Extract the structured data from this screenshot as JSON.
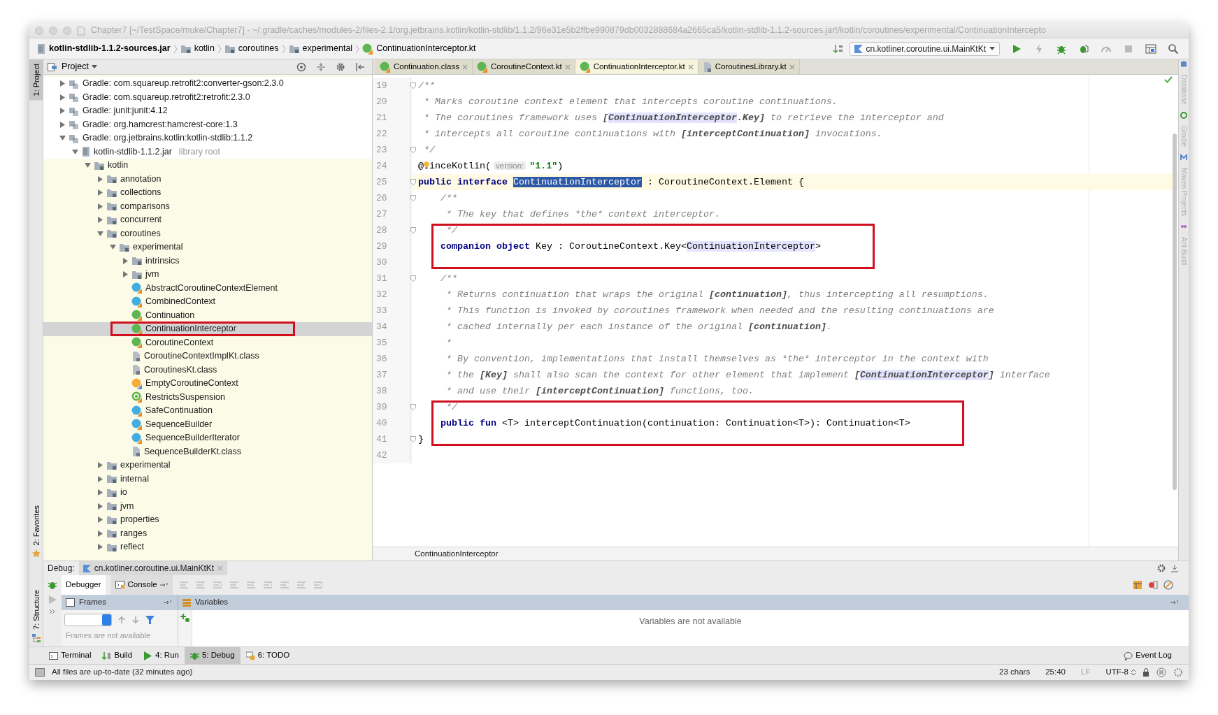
{
  "window": {
    "title": "Chapter7 [~/TestSpace/muke/Chapter7] - ~/.gradle/caches/modules-2/files-2.1/org.jetbrains.kotlin/kotlin-stdlib/1.1.2/96e31e5b2ffbe990879db0032888684a2665ca5/kotlin-stdlib-1.1.2-sources.jar!/kotlin/coroutines/experimental/ContinuationIntercepto"
  },
  "nav_bar": {
    "crumbs": [
      {
        "label": "kotlin-stdlib-1.1.2-sources.jar",
        "kind": "jar"
      },
      {
        "label": "kotlin",
        "kind": "package"
      },
      {
        "label": "coroutines",
        "kind": "package"
      },
      {
        "label": "experimental",
        "kind": "package"
      },
      {
        "label": "ContinuationInterceptor.kt",
        "kind": "interface"
      }
    ],
    "run_config": "cn.kotliner.coroutine.ui.MainKtKt"
  },
  "left_stripe": [
    {
      "label": "1: Project",
      "selected": true
    },
    {
      "label": "2: Favorites",
      "selected": false
    },
    {
      "label": "7: Structure",
      "selected": false
    }
  ],
  "right_stripe": [
    {
      "label": "Database",
      "kind": "database"
    },
    {
      "label": "Gradle",
      "kind": "gradle"
    },
    {
      "label": "Maven Projects",
      "kind": "maven"
    },
    {
      "label": "Ant Build",
      "kind": "ant"
    }
  ],
  "project_panel": {
    "title": "Project",
    "tree": [
      {
        "label": "Gradle: com.squareup.retrofit2:converter-gson:2.3.0",
        "kind": "library",
        "expanded": false,
        "selected": false
      },
      {
        "label": "Gradle: com.squareup.retrofit2:retrofit:2.3.0",
        "kind": "library",
        "expanded": false,
        "selected": false
      },
      {
        "label": "Gradle: junit:junit:4.12",
        "kind": "library",
        "expanded": false,
        "selected": false
      },
      {
        "label": "Gradle: org.hamcrest:hamcrest-core:1.3",
        "kind": "library",
        "expanded": false,
        "selected": false
      },
      {
        "label": "Gradle: org.jetbrains.kotlin:kotlin-stdlib:1.1.2",
        "kind": "library",
        "expanded": true,
        "selected": false,
        "children": [
          {
            "label": "kotlin-stdlib-1.1.2.jar",
            "note": "library root",
            "kind": "jar",
            "expanded": true,
            "selected": false,
            "children": [
              {
                "label": "kotlin",
                "kind": "package",
                "expanded": true,
                "selected": false,
                "children": [
                  {
                    "label": "annotation",
                    "kind": "package",
                    "expanded": false,
                    "selected": false
                  },
                  {
                    "label": "collections",
                    "kind": "package",
                    "expanded": false,
                    "selected": false
                  },
                  {
                    "label": "comparisons",
                    "kind": "package",
                    "expanded": false,
                    "selected": false
                  },
                  {
                    "label": "concurrent",
                    "kind": "package",
                    "expanded": false,
                    "selected": false
                  },
                  {
                    "label": "coroutines",
                    "kind": "package",
                    "expanded": true,
                    "selected": false,
                    "children": [
                      {
                        "label": "experimental",
                        "kind": "package",
                        "expanded": true,
                        "selected": false,
                        "children": [
                          {
                            "label": "intrinsics",
                            "kind": "package",
                            "expanded": false,
                            "selected": false
                          },
                          {
                            "label": "jvm",
                            "kind": "package",
                            "expanded": false,
                            "selected": false
                          },
                          {
                            "label": "AbstractCoroutineContextElement",
                            "kind": "class",
                            "selected": false
                          },
                          {
                            "label": "CombinedContext",
                            "kind": "class",
                            "selected": false
                          },
                          {
                            "label": "Continuation",
                            "kind": "interface",
                            "selected": false
                          },
                          {
                            "label": "ContinuationInterceptor",
                            "kind": "interface",
                            "selected": true,
                            "boxed": true
                          },
                          {
                            "label": "CoroutineContext",
                            "kind": "interface",
                            "selected": false
                          },
                          {
                            "label": "CoroutineContextImplKt.class",
                            "kind": "file",
                            "selected": false
                          },
                          {
                            "label": "CoroutinesKt.class",
                            "kind": "file",
                            "selected": false
                          },
                          {
                            "label": "EmptyCoroutineContext",
                            "kind": "object",
                            "selected": false
                          },
                          {
                            "label": "RestrictsSuspension",
                            "kind": "annotation",
                            "selected": false
                          },
                          {
                            "label": "SafeContinuation",
                            "kind": "class",
                            "selected": false
                          },
                          {
                            "label": "SequenceBuilder",
                            "kind": "class",
                            "selected": false
                          },
                          {
                            "label": "SequenceBuilderIterator",
                            "kind": "class",
                            "selected": false
                          },
                          {
                            "label": "SequenceBuilderKt.class",
                            "kind": "file",
                            "selected": false
                          }
                        ]
                      }
                    ]
                  },
                  {
                    "label": "experimental",
                    "kind": "package",
                    "expanded": false,
                    "selected": false
                  },
                  {
                    "label": "internal",
                    "kind": "package",
                    "expanded": false,
                    "selected": false
                  },
                  {
                    "label": "io",
                    "kind": "package",
                    "expanded": false,
                    "selected": false
                  },
                  {
                    "label": "jvm",
                    "kind": "package",
                    "expanded": false,
                    "selected": false
                  },
                  {
                    "label": "properties",
                    "kind": "package",
                    "expanded": false,
                    "selected": false
                  },
                  {
                    "label": "ranges",
                    "kind": "package",
                    "expanded": false,
                    "selected": false
                  },
                  {
                    "label": "reflect",
                    "kind": "package",
                    "expanded": false,
                    "selected": false
                  }
                ]
              }
            ]
          }
        ]
      }
    ]
  },
  "editor": {
    "tabs": [
      {
        "label": "Continuation.class",
        "kind": "interface",
        "selected": false
      },
      {
        "label": "CoroutineContext.kt",
        "kind": "interface",
        "selected": false
      },
      {
        "label": "ContinuationInterceptor.kt",
        "kind": "interface",
        "selected": true
      },
      {
        "label": "CoroutinesLibrary.kt",
        "kind": "file",
        "selected": false
      }
    ],
    "lines": [
      {
        "number": "19",
        "fold": true,
        "current": false,
        "tokens": [
          {
            "kind": "comment",
            "text": "/**"
          }
        ]
      },
      {
        "number": "20",
        "fold": false,
        "current": false,
        "tokens": [
          {
            "kind": "comment",
            "text": " * Marks coroutine context element that intercepts coroutine continuations."
          }
        ]
      },
      {
        "number": "21",
        "fold": false,
        "current": false,
        "tokens": [
          {
            "kind": "comment",
            "text": " * The coroutines framework uses "
          },
          {
            "kind": "docref",
            "text": "["
          },
          {
            "kind": "docref-hl",
            "text": "ContinuationInterceptor"
          },
          {
            "kind": "docref",
            "text": ".Key]"
          },
          {
            "kind": "comment",
            "text": " to retrieve the interceptor and"
          }
        ]
      },
      {
        "number": "22",
        "fold": false,
        "current": false,
        "tokens": [
          {
            "kind": "comment",
            "text": " * intercepts all coroutine continuations with "
          },
          {
            "kind": "docref",
            "text": "[interceptContinuation]"
          },
          {
            "kind": "comment",
            "text": " invocations."
          }
        ]
      },
      {
        "number": "23",
        "fold": true,
        "current": false,
        "tokens": [
          {
            "kind": "comment",
            "text": " */"
          }
        ]
      },
      {
        "number": "24",
        "fold": false,
        "current": false,
        "tokens": [
          {
            "kind": "plain",
            "text": "@"
          },
          {
            "kind": "bulb"
          },
          {
            "kind": "plain",
            "text": "inceKotlin("
          },
          {
            "kind": "hint",
            "text": "version:"
          },
          {
            "kind": "string",
            "text": "\"1.1\""
          },
          {
            "kind": "plain",
            "text": ")"
          }
        ]
      },
      {
        "number": "25",
        "fold": true,
        "current": true,
        "tokens": [
          {
            "kind": "keyword",
            "text": "public interface "
          },
          {
            "kind": "selection",
            "text": "ContinuationInterceptor"
          },
          {
            "kind": "plain",
            "text": " : CoroutineContext.Element {"
          }
        ]
      },
      {
        "number": "26",
        "fold": true,
        "current": false,
        "tokens": [
          {
            "kind": "comment",
            "text": "    /**"
          }
        ]
      },
      {
        "number": "27",
        "fold": false,
        "current": false,
        "tokens": [
          {
            "kind": "comment",
            "text": "     * The key that defines *the* context interceptor."
          }
        ]
      },
      {
        "number": "28",
        "fold": true,
        "current": false,
        "tokens": [
          {
            "kind": "comment",
            "text": "     */"
          }
        ]
      },
      {
        "number": "29",
        "fold": false,
        "current": false,
        "boxed": true,
        "tokens": [
          {
            "kind": "keyword",
            "text": "    companion object "
          },
          {
            "kind": "plain",
            "text": "Key : CoroutineContext.Key<"
          },
          {
            "kind": "ident-hl",
            "text": "ContinuationInterceptor"
          },
          {
            "kind": "plain",
            "text": ">"
          }
        ]
      },
      {
        "number": "30",
        "fold": false,
        "current": false
      },
      {
        "number": "31",
        "fold": true,
        "current": false,
        "tokens": [
          {
            "kind": "comment",
            "text": "    /**"
          }
        ]
      },
      {
        "number": "32",
        "fold": false,
        "current": false,
        "tokens": [
          {
            "kind": "comment",
            "text": "     * Returns continuation that wraps the original "
          },
          {
            "kind": "docref",
            "text": "[continuation]"
          },
          {
            "kind": "comment",
            "text": ", thus intercepting all resumptions."
          }
        ]
      },
      {
        "number": "33",
        "fold": false,
        "current": false,
        "tokens": [
          {
            "kind": "comment",
            "text": "     * This function is invoked by coroutines framework when needed and the resulting continuations are"
          }
        ]
      },
      {
        "number": "34",
        "fold": false,
        "current": false,
        "tokens": [
          {
            "kind": "comment",
            "text": "     * cached internally per each instance of the original "
          },
          {
            "kind": "docref",
            "text": "[continuation]"
          },
          {
            "kind": "comment",
            "text": "."
          }
        ]
      },
      {
        "number": "35",
        "fold": false,
        "current": false,
        "tokens": [
          {
            "kind": "comment",
            "text": "     *"
          }
        ]
      },
      {
        "number": "36",
        "fold": false,
        "current": false,
        "tokens": [
          {
            "kind": "comment",
            "text": "     * By convention, implementations that install themselves as *the* interceptor in the context with"
          }
        ]
      },
      {
        "number": "37",
        "fold": false,
        "current": false,
        "tokens": [
          {
            "kind": "comment",
            "text": "     * the "
          },
          {
            "kind": "docref",
            "text": "[Key]"
          },
          {
            "kind": "comment",
            "text": " shall also scan the context for other element that implement "
          },
          {
            "kind": "docref",
            "text": "["
          },
          {
            "kind": "docref-hl",
            "text": "ContinuationInterceptor"
          },
          {
            "kind": "docref",
            "text": "]"
          },
          {
            "kind": "comment",
            "text": " interface"
          }
        ]
      },
      {
        "number": "38",
        "fold": false,
        "current": false,
        "tokens": [
          {
            "kind": "comment",
            "text": "     * and use their "
          },
          {
            "kind": "docref",
            "text": "[interceptContinuation]"
          },
          {
            "kind": "comment",
            "text": " functions, too."
          }
        ]
      },
      {
        "number": "39",
        "fold": true,
        "current": false,
        "tokens": [
          {
            "kind": "comment",
            "text": "     */"
          }
        ]
      },
      {
        "number": "40",
        "fold": false,
        "current": false,
        "boxed": true,
        "tokens": [
          {
            "kind": "keyword",
            "text": "    public fun "
          },
          {
            "kind": "plain",
            "text": "<T> interceptContinuation(continuation: Continuation<T>): Continuation<T>"
          }
        ]
      },
      {
        "number": "41",
        "fold": true,
        "current": false,
        "tokens": [
          {
            "kind": "plain",
            "text": "}"
          }
        ]
      },
      {
        "number": "42",
        "fold": false,
        "current": false
      }
    ],
    "breadcrumb": "ContinuationInterceptor"
  },
  "debug": {
    "title": "Debug:",
    "session": "cn.kotliner.coroutine.ui.MainKtKt",
    "tabs": [
      {
        "label": "Debugger",
        "selected": true
      },
      {
        "label": "Console",
        "selected": false
      }
    ],
    "frames_title": "Frames",
    "variables_title": "Variables",
    "frames_message": "Frames are not available",
    "variables_message": "Variables are not available"
  },
  "tool_buttons": [
    {
      "label": "Terminal",
      "kind": "terminal",
      "selected": false
    },
    {
      "label": "Build",
      "kind": "build",
      "selected": false
    },
    {
      "label": "4: Run",
      "kind": "run",
      "selected": false
    },
    {
      "label": "5: Debug",
      "kind": "debug",
      "selected": true
    },
    {
      "label": "6: TODO",
      "kind": "todo",
      "selected": false
    }
  ],
  "event_log": "Event Log",
  "status_bar": {
    "message": "All files are up-to-date (32 minutes ago)",
    "fields": [
      "23 chars",
      "25:40",
      "LF",
      "UTF-8"
    ]
  }
}
